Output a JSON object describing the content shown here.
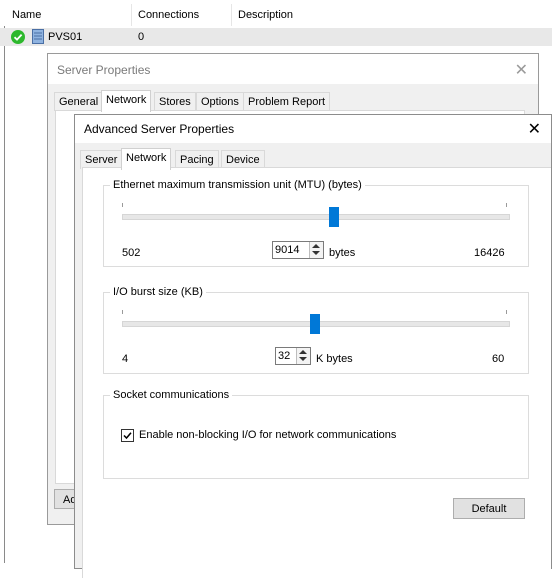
{
  "list": {
    "columns": [
      "Name",
      "Connections",
      "Description"
    ],
    "rows": [
      {
        "name": "PVS01",
        "connections": "0",
        "description": "",
        "status": "check-icon"
      }
    ]
  },
  "server_properties": {
    "title": "Server Properties",
    "tabs": [
      "General",
      "Network",
      "Stores",
      "Options",
      "Problem Report"
    ],
    "active_tab": "Network",
    "partial_button_label": "Ad"
  },
  "advanced": {
    "title": "Advanced Server Properties",
    "tabs": [
      "Server",
      "Network",
      "Pacing",
      "Device"
    ],
    "active_tab": "Network",
    "mtu": {
      "title": "Ethernet maximum transmission unit (MTU) (bytes)",
      "min": "502",
      "max": "16426",
      "value": "9014",
      "unit": "bytes",
      "fraction": 0.55
    },
    "burst": {
      "title": "I/O burst size (KB)",
      "min": "4",
      "max": "60",
      "value": "32",
      "unit": "K bytes",
      "fraction": 0.5
    },
    "socket": {
      "title": "Socket communications",
      "nonblocking_label": "Enable non-blocking I/O for network communications",
      "nonblocking_checked": true
    },
    "default_label": "Default"
  },
  "colors": {
    "accent": "#0078d7",
    "success": "#2db82d"
  }
}
